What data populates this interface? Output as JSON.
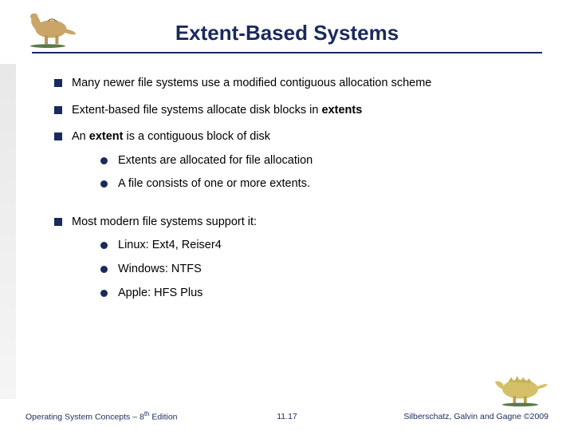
{
  "title": "Extent-Based Systems",
  "bullets": {
    "b1": "Many newer file systems use a modified contiguous allocation scheme",
    "b2_pre": "Extent-based file systems allocate disk blocks in ",
    "b2_bold": "extents",
    "b3_pre": "An ",
    "b3_bold": "extent",
    "b3_post": " is a contiguous block of disk",
    "b3_s1": "Extents are allocated for file allocation",
    "b3_s2": "A file consists of one or more extents.",
    "b4": "Most modern file systems support it:",
    "b4_s1": "Linux: Ext4, Reiser4",
    "b4_s2": "Windows: NTFS",
    "b4_s3": "Apple: HFS Plus"
  },
  "footer": {
    "left_pre": "Operating System Concepts – 8",
    "left_sup": "th",
    "left_post": " Edition",
    "center": "11.17",
    "right": "Silberschatz, Galvin and Gagne ©2009"
  }
}
